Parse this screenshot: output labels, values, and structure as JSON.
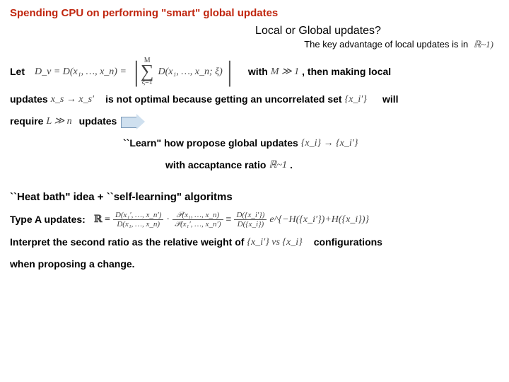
{
  "title": "Spending CPU on performing \"smart\" global updates",
  "subhead": "Local or Global updates?",
  "keyadv_prefix": "The key advantage of local updates is in ",
  "keyadv_math": "ℝ~1)",
  "p1": {
    "let": "Let",
    "dv_lhs": "D_v = D(x₁, …, x_n) =",
    "sum_top": "M",
    "sum_bot": "ξ=1",
    "sum_body": "D(x₁, …, x_n; ξ)",
    "with": "with",
    "mgg1": "M ≫ 1",
    "tail": ", then making local"
  },
  "p2": {
    "updates": "updates",
    "xsxsp": "x_s → x_s′",
    "mid": "is not optimal because getting an uncorrelated set",
    "set": "{x_i′}",
    "will": "will"
  },
  "p3": {
    "require": "require",
    "lggn": "L ≫ n",
    "updates": "updates"
  },
  "learn": {
    "text": "``Learn\" how propose global updates",
    "map": "{x_i} → {x_i′}"
  },
  "accept": {
    "text": "with accaptance ratio",
    "r": "ℝ~1",
    "dot": "."
  },
  "heat": "``Heat bath\" idea   + ``self-learning\" algoritms",
  "typeA": {
    "label": "Type A updates:",
    "r": "ℝ =",
    "f1n": "D(x₁′, …, x_n′)",
    "f1d": "D(x₁, …, x_n)",
    "f2n": "𝒫(x₁, …, x_n)",
    "f2d": "𝒫(x₁′, …, x_n′)",
    "eq": "≡",
    "f3n": "D({x_i′})",
    "f3d": "D({x_i})",
    "exp": "e^{−H({x_i′})+H({x_i})}"
  },
  "interp": {
    "a": "Interpret the second ratio as the relative weight of",
    "m": "{x_i′} vs {x_i}",
    "b": "configurations"
  },
  "last": "when proposing a change."
}
